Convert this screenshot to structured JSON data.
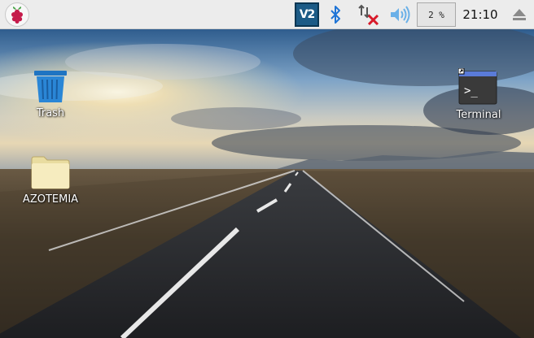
{
  "taskbar": {
    "menu_icon": "raspberry-pi-logo-icon",
    "tray": {
      "vnc_icon": "vnc-server-icon",
      "vnc_text": "V2",
      "bluetooth_icon": "bluetooth-icon",
      "network_icon": "network-disconnected-icon",
      "volume_icon": "volume-icon",
      "cpu_usage": "2 %",
      "clock": "21:10",
      "eject_icon": "eject-icon"
    }
  },
  "desktop": {
    "icons": [
      {
        "label": "Trash",
        "icon": "trash-icon"
      },
      {
        "label": "AZOTEMIA",
        "icon": "folder-icon"
      },
      {
        "label": "Terminal",
        "icon": "terminal-icon",
        "glyph": ">_"
      }
    ]
  },
  "colors": {
    "taskbar_bg": "#ececec",
    "vnc_blue": "#1c5b86",
    "bluetooth_blue": "#1e74d6",
    "network_red": "#d81a2a",
    "trash_blue": "#2a86d6",
    "folder_yellow": "#f4e9b6"
  }
}
